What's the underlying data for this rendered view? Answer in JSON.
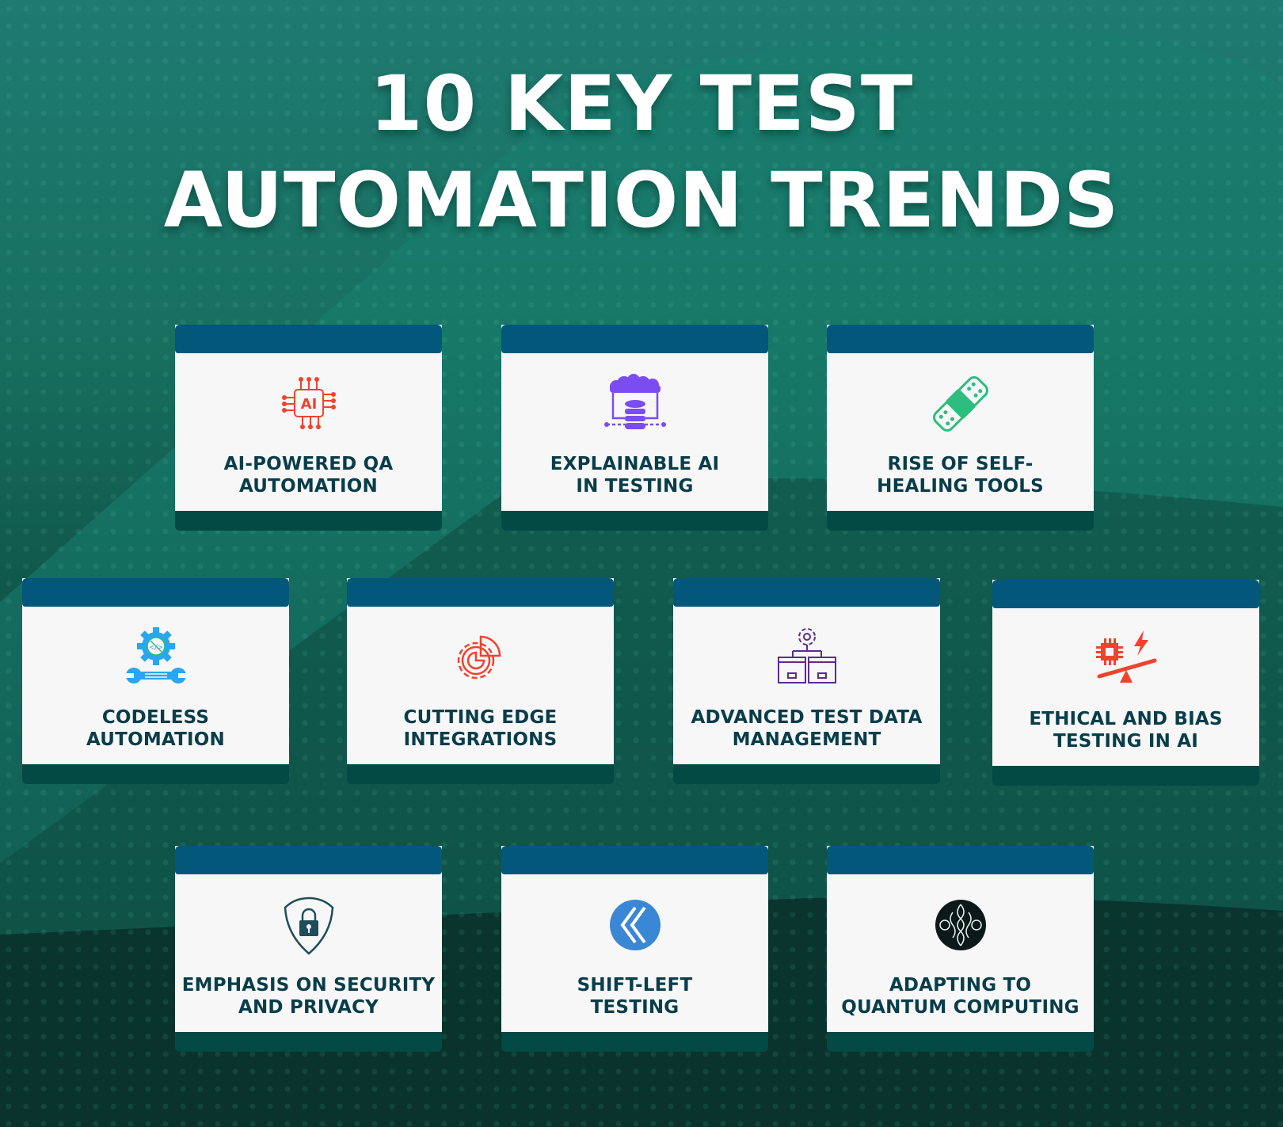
{
  "title": {
    "line1": "10 KEY TEST",
    "line2": "AUTOMATION TRENDS"
  },
  "colors": {
    "card_header": "#02577a",
    "card_body": "#f7f7f7",
    "card_footer": "#034a44",
    "label_text": "#083d4a",
    "title_text": "#ffffff"
  },
  "trends": [
    {
      "label_line1": "AI-POWERED QA",
      "label_line2": "AUTOMATION",
      "icon": "ai-chip-icon",
      "icon_color": "#f0432e"
    },
    {
      "label_line1": "EXPLAINABLE AI",
      "label_line2": "IN TESTING",
      "icon": "cloud-database-icon",
      "icon_color": "#7b4cf2"
    },
    {
      "label_line1": "RISE OF SELF-",
      "label_line2": "HEALING TOOLS",
      "icon": "bandage-icon",
      "icon_color": "#2dbd7e"
    },
    {
      "label_line1": "CODELESS",
      "label_line2": "AUTOMATION",
      "icon": "gear-wrench-icon",
      "icon_color": "#2aa6ef"
    },
    {
      "label_line1": "CUTTING EDGE",
      "label_line2": "INTEGRATIONS",
      "icon": "gear-integration-icon",
      "icon_color": "#f0432e"
    },
    {
      "label_line1": "ADVANCED TEST DATA",
      "label_line2": "MANAGEMENT",
      "icon": "gear-folders-icon",
      "icon_color": "#5b2d8c"
    },
    {
      "label_line1": "ETHICAL AND BIAS",
      "label_line2": "TESTING IN AI",
      "icon": "chip-scale-icon",
      "icon_color": "#f0432e"
    },
    {
      "label_line1": "EMPHASIS ON SECURITY",
      "label_line2": "AND PRIVACY",
      "icon": "shield-lock-icon",
      "icon_color": "#1f4e5a"
    },
    {
      "label_line1": "SHIFT-LEFT",
      "label_line2": "TESTING",
      "icon": "double-chevron-left-icon",
      "icon_color": "#3a87d6"
    },
    {
      "label_line1": "ADAPTING TO",
      "label_line2": "QUANTUM COMPUTING",
      "icon": "quantum-icon",
      "icon_color": "#0b1a18"
    }
  ]
}
